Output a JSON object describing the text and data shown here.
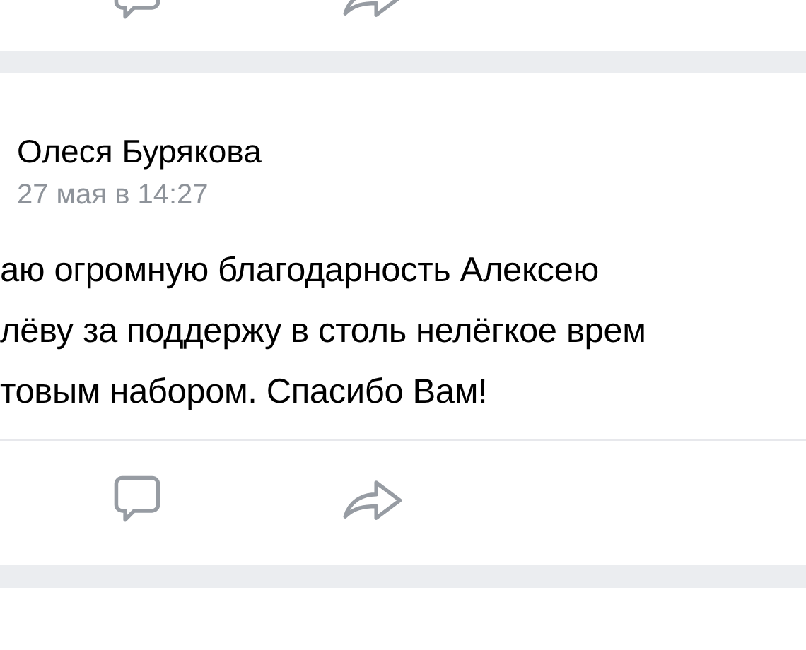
{
  "post": {
    "author": "Олеся Бурякова",
    "date": "27 мая в 14:27",
    "text_lines": [
      "аю огромную благодарность Алексею",
      "лёву за поддержу в столь нелёгкое врем",
      "товым набором. Спасибо Вам!"
    ]
  }
}
